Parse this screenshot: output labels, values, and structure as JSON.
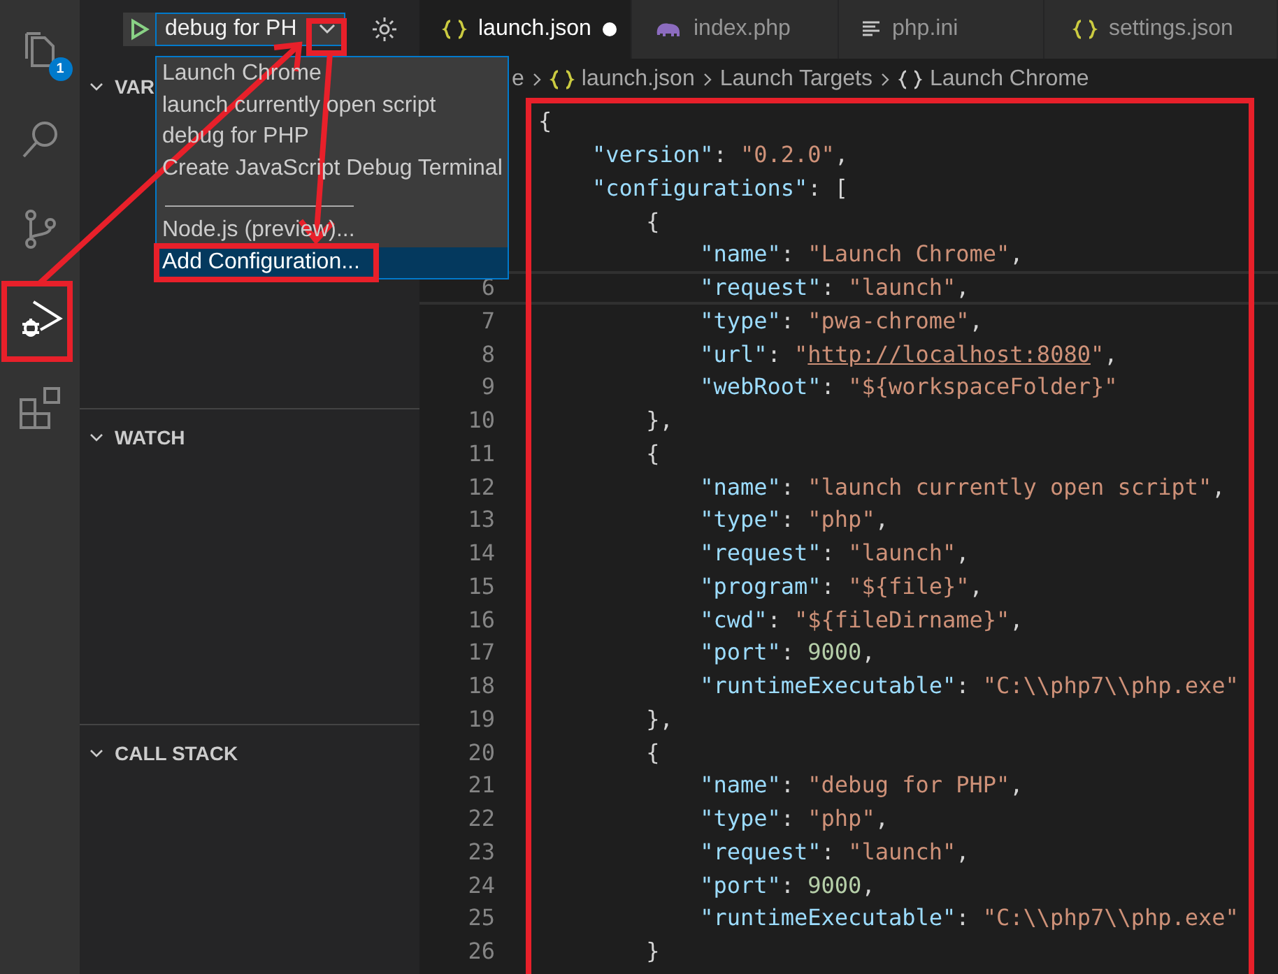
{
  "activity_bar": [
    {
      "selected": false,
      "badge": "1"
    },
    {
      "selected": false
    },
    {
      "selected": false
    },
    {
      "selected": true
    },
    {
      "selected": false
    }
  ],
  "debug_toolbar": {
    "config_select": {
      "value": "debug for PH"
    }
  },
  "config_dropdown": {
    "items": [
      {
        "kind": "option",
        "label": "Launch Chrome",
        "selected": false
      },
      {
        "kind": "option",
        "label": "launch currently open script",
        "selected": false
      },
      {
        "kind": "option",
        "label": "debug for PHP",
        "selected": false
      },
      {
        "kind": "option",
        "label": "Create JavaScript Debug Terminal",
        "selected": false
      },
      {
        "kind": "separator"
      },
      {
        "kind": "option",
        "label": "Node.js (preview)...",
        "selected": false
      },
      {
        "kind": "option",
        "label": "Add Configuration...",
        "selected": true
      }
    ]
  },
  "sidebar_sections": [
    {
      "title": "VAR",
      "expanded": true
    },
    {
      "title": "WATCH",
      "expanded": true
    },
    {
      "title": "CALL STACK",
      "expanded": true
    }
  ],
  "tabs": [
    {
      "label": "launch.json",
      "kind": "json",
      "selected": true,
      "modified": true
    },
    {
      "label": "index.php",
      "kind": "php",
      "selected": false,
      "modified": false
    },
    {
      "label": "php.ini",
      "kind": "ini",
      "selected": false,
      "modified": false
    },
    {
      "label": "settings.json",
      "kind": "json",
      "selected": false,
      "modified": false
    }
  ],
  "breadcrumb": [
    {
      "label": "e",
      "kind": "folder"
    },
    {
      "label": "launch.json",
      "kind": "json"
    },
    {
      "label": "Launch Targets",
      "kind": "group"
    },
    {
      "label": "Launch Chrome",
      "kind": "object"
    }
  ],
  "code_lines": [
    {
      "current": false,
      "tokens": [
        {
          "kind": "punct",
          "text": "{"
        }
      ]
    },
    {
      "current": false,
      "tokens": [
        {
          "kind": "key",
          "text": "    \"version\""
        },
        {
          "kind": "punct",
          "text": ": "
        },
        {
          "kind": "string",
          "text": "\"0.2.0\""
        },
        {
          "kind": "punct",
          "text": ","
        }
      ]
    },
    {
      "current": false,
      "tokens": [
        {
          "kind": "key",
          "text": "    \"configurations\""
        },
        {
          "kind": "punct",
          "text": ": ["
        }
      ]
    },
    {
      "current": false,
      "tokens": [
        {
          "kind": "punct",
          "text": "        {"
        }
      ]
    },
    {
      "current": false,
      "tokens": [
        {
          "kind": "key",
          "text": "            \"name\""
        },
        {
          "kind": "punct",
          "text": ": "
        },
        {
          "kind": "string",
          "text": "\"Launch Chrome\""
        },
        {
          "kind": "punct",
          "text": ","
        }
      ]
    },
    {
      "number": "6",
      "current": true,
      "tokens": [
        {
          "kind": "key",
          "text": "            \"request\""
        },
        {
          "kind": "punct",
          "text": ": "
        },
        {
          "kind": "string",
          "text": "\"launch\""
        },
        {
          "kind": "punct",
          "text": ","
        }
      ]
    },
    {
      "number": "7",
      "current": false,
      "tokens": [
        {
          "kind": "key",
          "text": "            \"type\""
        },
        {
          "kind": "punct",
          "text": ": "
        },
        {
          "kind": "string",
          "text": "\"pwa-chrome\""
        },
        {
          "kind": "punct",
          "text": ","
        }
      ]
    },
    {
      "number": "8",
      "current": false,
      "tokens": [
        {
          "kind": "key",
          "text": "            \"url\""
        },
        {
          "kind": "punct",
          "text": ": "
        },
        {
          "kind": "string",
          "text": "\""
        },
        {
          "kind": "link",
          "text": "http://localhost:8080"
        },
        {
          "kind": "string",
          "text": "\""
        },
        {
          "kind": "punct",
          "text": ","
        }
      ]
    },
    {
      "number": "9",
      "current": false,
      "tokens": [
        {
          "kind": "key",
          "text": "            \"webRoot\""
        },
        {
          "kind": "punct",
          "text": ": "
        },
        {
          "kind": "string",
          "text": "\"${workspaceFolder}\""
        }
      ]
    },
    {
      "number": "10",
      "current": false,
      "tokens": [
        {
          "kind": "punct",
          "text": "        },"
        }
      ]
    },
    {
      "number": "11",
      "current": false,
      "tokens": [
        {
          "kind": "punct",
          "text": "        {"
        }
      ]
    },
    {
      "number": "12",
      "current": false,
      "tokens": [
        {
          "kind": "key",
          "text": "            \"name\""
        },
        {
          "kind": "punct",
          "text": ": "
        },
        {
          "kind": "string",
          "text": "\"launch currently open script\""
        },
        {
          "kind": "punct",
          "text": ","
        }
      ]
    },
    {
      "number": "13",
      "current": false,
      "tokens": [
        {
          "kind": "key",
          "text": "            \"type\""
        },
        {
          "kind": "punct",
          "text": ": "
        },
        {
          "kind": "string",
          "text": "\"php\""
        },
        {
          "kind": "punct",
          "text": ","
        }
      ]
    },
    {
      "number": "14",
      "current": false,
      "tokens": [
        {
          "kind": "key",
          "text": "            \"request\""
        },
        {
          "kind": "punct",
          "text": ": "
        },
        {
          "kind": "string",
          "text": "\"launch\""
        },
        {
          "kind": "punct",
          "text": ","
        }
      ]
    },
    {
      "number": "15",
      "current": false,
      "tokens": [
        {
          "kind": "key",
          "text": "            \"program\""
        },
        {
          "kind": "punct",
          "text": ": "
        },
        {
          "kind": "string",
          "text": "\"${file}\""
        },
        {
          "kind": "punct",
          "text": ","
        }
      ]
    },
    {
      "number": "16",
      "current": false,
      "tokens": [
        {
          "kind": "key",
          "text": "            \"cwd\""
        },
        {
          "kind": "punct",
          "text": ": "
        },
        {
          "kind": "string",
          "text": "\"${fileDirname}\""
        },
        {
          "kind": "punct",
          "text": ","
        }
      ]
    },
    {
      "number": "17",
      "current": false,
      "tokens": [
        {
          "kind": "key",
          "text": "            \"port\""
        },
        {
          "kind": "punct",
          "text": ": "
        },
        {
          "kind": "number",
          "text": "9000"
        },
        {
          "kind": "punct",
          "text": ","
        }
      ]
    },
    {
      "number": "18",
      "current": false,
      "tokens": [
        {
          "kind": "key",
          "text": "            \"runtimeExecutable\""
        },
        {
          "kind": "punct",
          "text": ": "
        },
        {
          "kind": "string",
          "text": "\"C:\\\\php7\\\\php.exe\""
        }
      ]
    },
    {
      "number": "19",
      "current": false,
      "tokens": [
        {
          "kind": "punct",
          "text": "        },"
        }
      ]
    },
    {
      "number": "20",
      "current": false,
      "tokens": [
        {
          "kind": "punct",
          "text": "        {"
        }
      ]
    },
    {
      "number": "21",
      "current": false,
      "tokens": [
        {
          "kind": "key",
          "text": "            \"name\""
        },
        {
          "kind": "punct",
          "text": ": "
        },
        {
          "kind": "string",
          "text": "\"debug for PHP\""
        },
        {
          "kind": "punct",
          "text": ","
        }
      ]
    },
    {
      "number": "22",
      "current": false,
      "tokens": [
        {
          "kind": "key",
          "text": "            \"type\""
        },
        {
          "kind": "punct",
          "text": ": "
        },
        {
          "kind": "string",
          "text": "\"php\""
        },
        {
          "kind": "punct",
          "text": ","
        }
      ]
    },
    {
      "number": "23",
      "current": false,
      "tokens": [
        {
          "kind": "key",
          "text": "            \"request\""
        },
        {
          "kind": "punct",
          "text": ": "
        },
        {
          "kind": "string",
          "text": "\"launch\""
        },
        {
          "kind": "punct",
          "text": ","
        }
      ]
    },
    {
      "number": "24",
      "current": false,
      "tokens": [
        {
          "kind": "key",
          "text": "            \"port\""
        },
        {
          "kind": "punct",
          "text": ": "
        },
        {
          "kind": "number",
          "text": "9000"
        },
        {
          "kind": "punct",
          "text": ","
        }
      ]
    },
    {
      "number": "25",
      "current": false,
      "tokens": [
        {
          "kind": "key",
          "text": "            \"runtimeExecutable\""
        },
        {
          "kind": "punct",
          "text": ": "
        },
        {
          "kind": "string",
          "text": "\"C:\\\\php7\\\\php.exe\""
        }
      ]
    },
    {
      "number": "26",
      "current": false,
      "tokens": [
        {
          "kind": "punct",
          "text": "        }"
        }
      ]
    }
  ]
}
